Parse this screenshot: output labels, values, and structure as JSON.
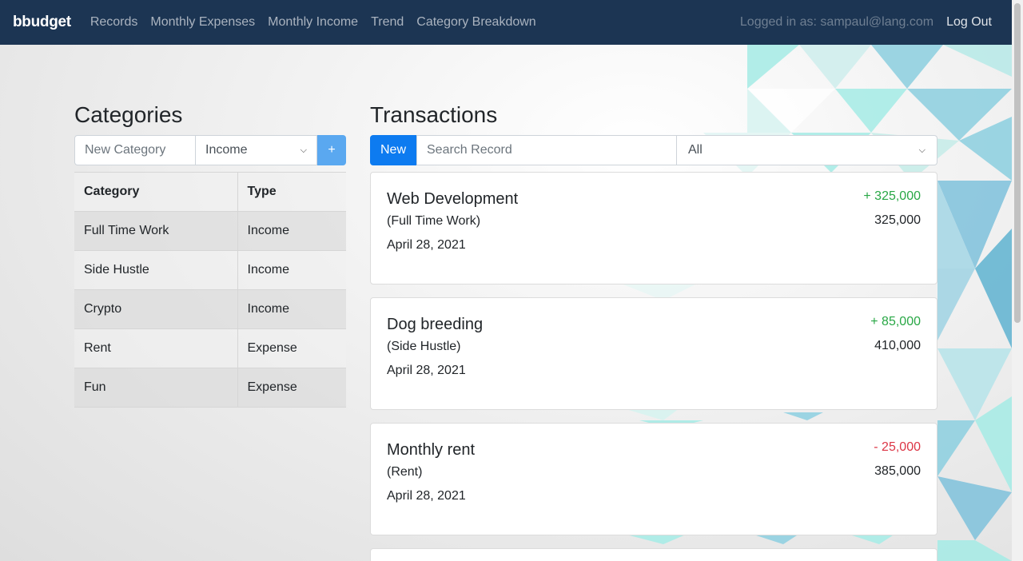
{
  "nav": {
    "brand": "bbudget",
    "links": [
      "Records",
      "Monthly Expenses",
      "Monthly Income",
      "Trend",
      "Category Breakdown"
    ],
    "logged_in": "Logged in as: sampaul@lang.com",
    "logout": "Log Out"
  },
  "categories": {
    "title": "Categories",
    "input_placeholder": "New Category",
    "type_selected": "Income",
    "add_label": "+",
    "columns": [
      "Category",
      "Type"
    ],
    "rows": [
      {
        "name": "Full Time Work",
        "type": "Income"
      },
      {
        "name": "Side Hustle",
        "type": "Income"
      },
      {
        "name": "Crypto",
        "type": "Income"
      },
      {
        "name": "Rent",
        "type": "Expense"
      },
      {
        "name": "Fun",
        "type": "Expense"
      }
    ]
  },
  "transactions": {
    "title": "Transactions",
    "new_label": "New",
    "search_placeholder": "Search Record",
    "filter_selected": "All",
    "items": [
      {
        "title": "Web Development",
        "category": "(Full Time Work)",
        "date": "April 28, 2021",
        "amount": "+ 325,000",
        "balance": "325,000"
      },
      {
        "title": "Dog breeding",
        "category": "(Side Hustle)",
        "date": "April 28, 2021",
        "amount": "+ 85,000",
        "balance": "410,000"
      },
      {
        "title": "Monthly rent",
        "category": "(Rent)",
        "date": "April 28, 2021",
        "amount": "- 25,000",
        "balance": "385,000"
      }
    ]
  },
  "colors": {
    "navbar": "#1c3553",
    "primary": "#0d7bf0",
    "income": "#28a745",
    "expense": "#dc3545"
  }
}
